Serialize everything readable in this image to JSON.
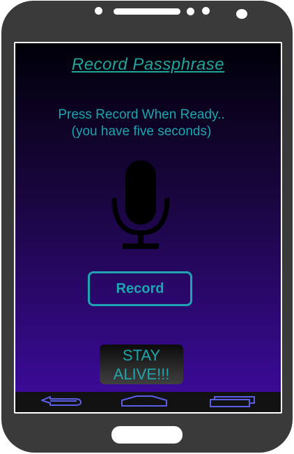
{
  "screen": {
    "title": "Record Passphrase",
    "instruction_line1": "Press  Record When Ready..",
    "instruction_line2": "(you have five seconds)",
    "record_button": "Record",
    "stay_alive_line1": "STAY",
    "stay_alive_line2": "ALIVE!!!"
  },
  "icons": {
    "mic": "microphone-icon",
    "nav_back": "back-arrow-icon",
    "nav_home": "home-icon",
    "nav_recents": "recent-apps-icon"
  },
  "colors": {
    "accent": "#1ea5b1",
    "background_top": "#000008",
    "background_bottom": "#3a0a96",
    "nav_icons": "#5a5ee8"
  }
}
